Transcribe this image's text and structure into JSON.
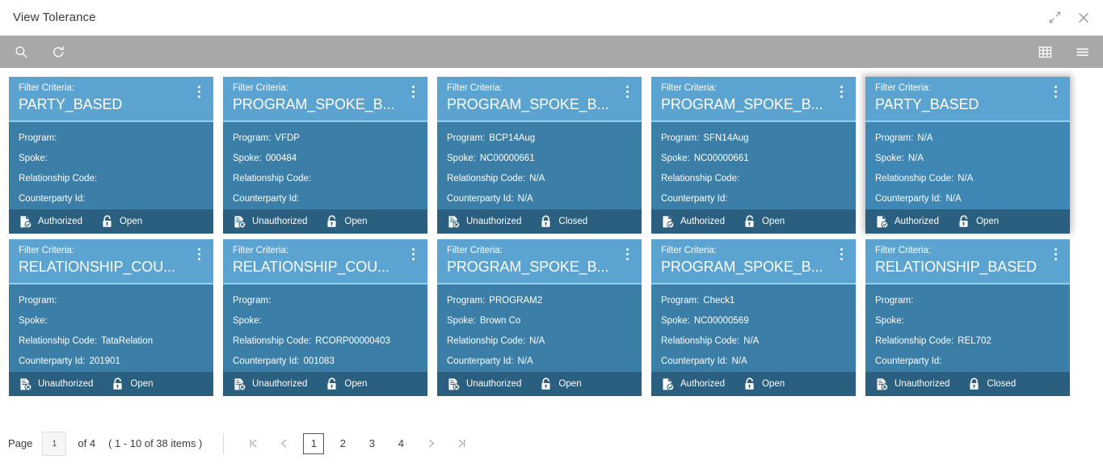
{
  "titlebar": {
    "title": "View Tolerance",
    "minimize_icon": "collapse-arrows-icon",
    "close_icon": "close-icon"
  },
  "toolbar": {
    "search_icon": "search-icon",
    "refresh_icon": "refresh-icon",
    "grid_view_icon": "grid-view-icon",
    "list_view_icon": "list-view-icon"
  },
  "card_labels": {
    "criteria": "Filter Criteria:",
    "program": "Program:",
    "spoke": "Spoke:",
    "relationship_code": "Relationship Code:",
    "counterparty_id": "Counterparty Id:",
    "kebab_icon": "more-options-icon"
  },
  "colors": {
    "card_header": "#5ba3d0",
    "card_body": "#3b7ea8",
    "card_body_selected": "#3f87b4",
    "card_footer": "#2b5f80",
    "divider": "#8fd0ef",
    "toolbar": "#a8a8a8"
  },
  "cards": [
    {
      "criteria": "PARTY_BASED",
      "program": "",
      "spoke": "",
      "relationship_code": "",
      "counterparty_id": "",
      "auth_status": "Authorized",
      "auth_icon": "document-check-icon",
      "record_status": "Open",
      "record_icon": "lock-open-icon",
      "selected": false
    },
    {
      "criteria": "PROGRAM_SPOKE_B...",
      "program": "VFDP",
      "spoke": "000484",
      "relationship_code": "",
      "counterparty_id": "",
      "auth_status": "Unauthorized",
      "auth_icon": "document-x-icon",
      "record_status": "Open",
      "record_icon": "lock-open-icon",
      "selected": false
    },
    {
      "criteria": "PROGRAM_SPOKE_B...",
      "program": "BCP14Aug",
      "spoke": "NC00000661",
      "relationship_code": "N/A",
      "counterparty_id": "N/A",
      "auth_status": "Unauthorized",
      "auth_icon": "document-x-icon",
      "record_status": "Closed",
      "record_icon": "lock-closed-icon",
      "selected": false
    },
    {
      "criteria": "PROGRAM_SPOKE_B...",
      "program": "SFN14Aug",
      "spoke": "NC00000661",
      "relationship_code": "",
      "counterparty_id": "",
      "auth_status": "Authorized",
      "auth_icon": "document-check-icon",
      "record_status": "Open",
      "record_icon": "lock-open-icon",
      "selected": false
    },
    {
      "criteria": "PARTY_BASED",
      "program": "N/A",
      "spoke": "N/A",
      "relationship_code": "N/A",
      "counterparty_id": "N/A",
      "auth_status": "Authorized",
      "auth_icon": "document-check-icon",
      "record_status": "Open",
      "record_icon": "lock-open-icon",
      "selected": true
    },
    {
      "criteria": "RELATIONSHIP_COU...",
      "program": "",
      "spoke": "",
      "relationship_code": "TataRelation",
      "counterparty_id": "201901",
      "auth_status": "Unauthorized",
      "auth_icon": "document-x-icon",
      "record_status": "Open",
      "record_icon": "lock-open-icon",
      "selected": false
    },
    {
      "criteria": "RELATIONSHIP_COU...",
      "program": "",
      "spoke": "",
      "relationship_code": "RCORP00000403",
      "counterparty_id": "001083",
      "auth_status": "Unauthorized",
      "auth_icon": "document-x-icon",
      "record_status": "Open",
      "record_icon": "lock-open-icon",
      "selected": false
    },
    {
      "criteria": "PROGRAM_SPOKE_B...",
      "program": "PROGRAM2",
      "spoke": "Brown Co",
      "relationship_code": "N/A",
      "counterparty_id": "N/A",
      "auth_status": "Unauthorized",
      "auth_icon": "document-x-icon",
      "record_status": "Open",
      "record_icon": "lock-open-icon",
      "selected": false
    },
    {
      "criteria": "PROGRAM_SPOKE_B...",
      "program": "Check1",
      "spoke": "NC00000569",
      "relationship_code": "N/A",
      "counterparty_id": "N/A",
      "auth_status": "Authorized",
      "auth_icon": "document-check-icon",
      "record_status": "Open",
      "record_icon": "lock-open-icon",
      "selected": false
    },
    {
      "criteria": "RELATIONSHIP_BASED",
      "program": "",
      "spoke": "",
      "relationship_code": "REL702",
      "counterparty_id": "",
      "auth_status": "Unauthorized",
      "auth_icon": "document-x-icon",
      "record_status": "Closed",
      "record_icon": "lock-closed-icon",
      "selected": false
    }
  ],
  "pagination": {
    "page_label": "Page",
    "page_value": "1",
    "of_text": "of 4",
    "range_text": "( 1 - 10 of 38 items )",
    "first_icon": "first-page-icon",
    "prev_icon": "prev-page-icon",
    "next_icon": "next-page-icon",
    "last_icon": "last-page-icon",
    "pages": [
      "1",
      "2",
      "3",
      "4"
    ],
    "active_page": "1"
  }
}
